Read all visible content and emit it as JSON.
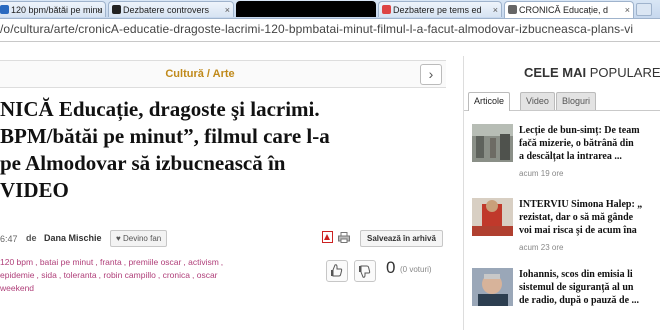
{
  "browser": {
    "tabs": [
      {
        "label": "120 bpm/bătăi pe minu",
        "redacted": false,
        "fav": "#2a6ac0"
      },
      {
        "label": "Dezbatere controvers",
        "redacted": false,
        "fav": "#222"
      },
      {
        "label": "",
        "redacted": true,
        "fav": ""
      },
      {
        "label": "Dezbatere pe tems ed",
        "redacted": false,
        "fav": "#d44"
      },
      {
        "label": "CRONICĂ Educație, d",
        "redacted": false,
        "fav": "#666"
      }
    ],
    "url": "/o/cultura/arte/cronicA-educatie-dragoste-lacrimi-120-bpmbatai-minut-filmul-l-a-facut-almodovar-izbucneasca-plans-vi"
  },
  "article": {
    "breadcrumb": "Cultură / Arte",
    "next_arrow": "›",
    "headline_lines": [
      "NICĂ Educație, dragoste şi lacrimi.",
      "BPM/bătăi pe minut”, filmul care l-a",
      "pe Almodovar să izbucnească în",
      "VIDEO"
    ],
    "time": "6:47",
    "by": "de",
    "author": "Dana Mischie",
    "fan_label": "♥ Devino fan",
    "save_label": "Salvează în arhivă",
    "tags": [
      "120 bpm",
      "batai pe minut",
      "franta",
      "premiile oscar",
      "activism",
      "epidemie",
      "sida",
      "toleranta",
      "robin campillo",
      "cronica",
      "oscar",
      "weekend"
    ],
    "vote_count": "0",
    "vote_label": "(0 voturi)"
  },
  "sidebar": {
    "title_bold": "CELE MAI",
    "title_rest": " POPULARE",
    "tabs": [
      "Articole",
      "Video",
      "Bloguri"
    ],
    "items": [
      {
        "line1": "Lecție de bun-simț: De team",
        "line2": "fac̆ă mizerie, o bătrână din",
        "line3": "a descălțat la intrarea ...",
        "time": "acum 19 ore"
      },
      {
        "line1": "INTERVIU Simona Halep: „",
        "line2": "rezistat, dar o să mă gânde",
        "line3": "voi mai risca şi de acum îna",
        "time": "acum 23 ore"
      },
      {
        "line1": "Iohannis, scos din emisia li",
        "line2": "sistemul de siguranță al un",
        "line3": "de radio, după o pauză de ...",
        "time": ""
      }
    ]
  }
}
